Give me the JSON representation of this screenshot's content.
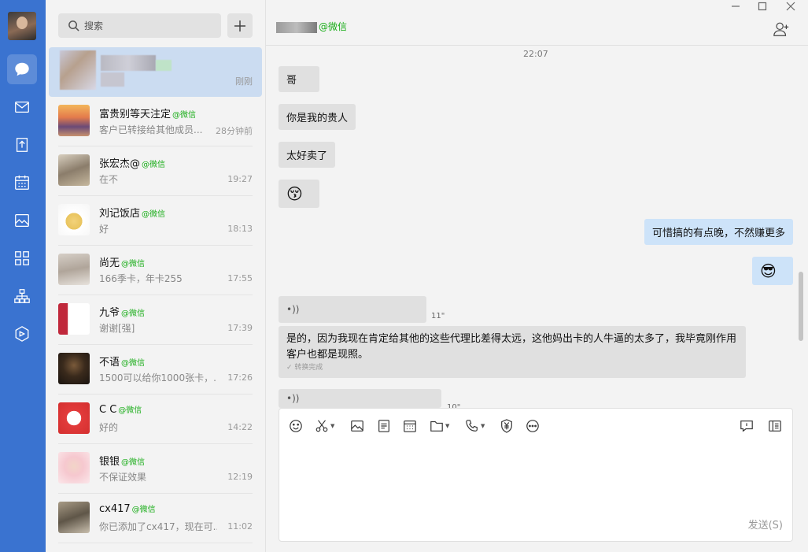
{
  "search": {
    "placeholder": "搜索"
  },
  "conversations": [
    {
      "name": "",
      "tag": "",
      "msg": "",
      "time": "刚刚",
      "selected": true
    },
    {
      "name": "富贵别等天注定",
      "tag": "@微信",
      "msg": "客户已转接给其他成员...",
      "time": "28分钟前"
    },
    {
      "name": "张宏杰@",
      "tag": "@微信",
      "msg": "在不",
      "time": "19:27"
    },
    {
      "name": "刘记饭店",
      "tag": "@微信",
      "msg": "好",
      "time": "18:13"
    },
    {
      "name": "尚无",
      "tag": "@微信",
      "msg": "166季卡，年卡255",
      "time": "17:55"
    },
    {
      "name": "九爷",
      "tag": "@微信",
      "msg": "谢谢[强]",
      "time": "17:39"
    },
    {
      "name": "不语",
      "tag": "@微信",
      "msg": "1500可以给你1000张卡，...",
      "time": "17:26"
    },
    {
      "name": "C C",
      "tag": "@微信",
      "msg": "好的",
      "time": "14:22"
    },
    {
      "name": "银银",
      "tag": "@微信",
      "msg": "不保证效果",
      "time": "12:19"
    },
    {
      "name": "cx417",
      "tag": "@微信",
      "msg": "你已添加了cx417，现在可...",
      "time": "11:02"
    }
  ],
  "chat": {
    "title_suffix": "@微信",
    "timestamp": "22:07",
    "messages": {
      "m1": "哥",
      "m2": "你是我的贵人",
      "m3": "太好卖了",
      "m4": "😚",
      "m5": "可惜搞的有点晚，不然赚更多",
      "m6": "😎",
      "voice1_duration": "11\"",
      "voice_icon": "•))",
      "long_text": "是的，因为我现在肯定给其他的这些代理比差得太远，这他妈出卡的人牛逼的太多了，我毕竟刚作用客户也都是现照。",
      "long_status": "✓ 转换完成",
      "voice2_duration": "10\""
    },
    "send_label": "发送(S)"
  },
  "colors": {
    "rail": "#3a73d0",
    "accent_green": "#1aad19",
    "bubble_in": "#e0e0e0",
    "bubble_out": "#cde3f9"
  }
}
